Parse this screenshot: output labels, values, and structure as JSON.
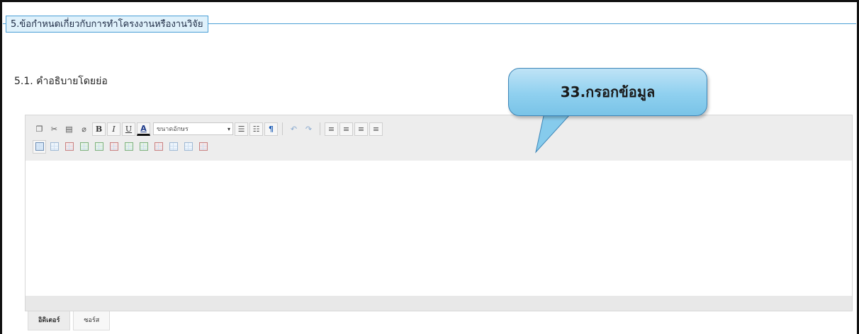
{
  "section": {
    "title": "5.ข้อกำหนดเกี่ยวกับการทำโครงงานหรืองานวิจัย"
  },
  "field": {
    "label": "5.1. คำอธิบายโดยย่อ",
    "value": ""
  },
  "callout": {
    "text": "33.กรอกข้อมูล"
  },
  "editor": {
    "font_size_label": "ขนาดอักษร",
    "toolbar_row1": [
      {
        "name": "copy-icon",
        "glyph": "❐"
      },
      {
        "name": "cut-icon",
        "glyph": "✂"
      },
      {
        "name": "paste-icon",
        "glyph": "📋"
      },
      {
        "name": "eraser-icon",
        "glyph": "⌫"
      },
      {
        "name": "bold-button",
        "glyph": "B"
      },
      {
        "name": "italic-button",
        "glyph": "I"
      },
      {
        "name": "underline-button",
        "glyph": "U"
      },
      {
        "name": "font-color-icon",
        "glyph": "A"
      }
    ],
    "toolbar_row1b": [
      {
        "name": "ordered-list-icon",
        "glyph": "☰"
      },
      {
        "name": "unordered-list-icon",
        "glyph": "☷"
      },
      {
        "name": "paragraph-icon",
        "glyph": "¶"
      },
      {
        "name": "undo-icon",
        "glyph": "↶"
      },
      {
        "name": "redo-icon",
        "glyph": "↷"
      },
      {
        "name": "align-left-icon",
        "glyph": "≡"
      },
      {
        "name": "align-center-icon",
        "glyph": "≡"
      },
      {
        "name": "align-right-icon",
        "glyph": "≡"
      },
      {
        "name": "align-justify-icon",
        "glyph": "≡"
      }
    ],
    "tabs": {
      "editor": "อิดิเตอร์",
      "source": "ซอร์ส"
    }
  },
  "colors": {
    "accent": "#4a9fd6",
    "callout": "#8fd0ef"
  }
}
